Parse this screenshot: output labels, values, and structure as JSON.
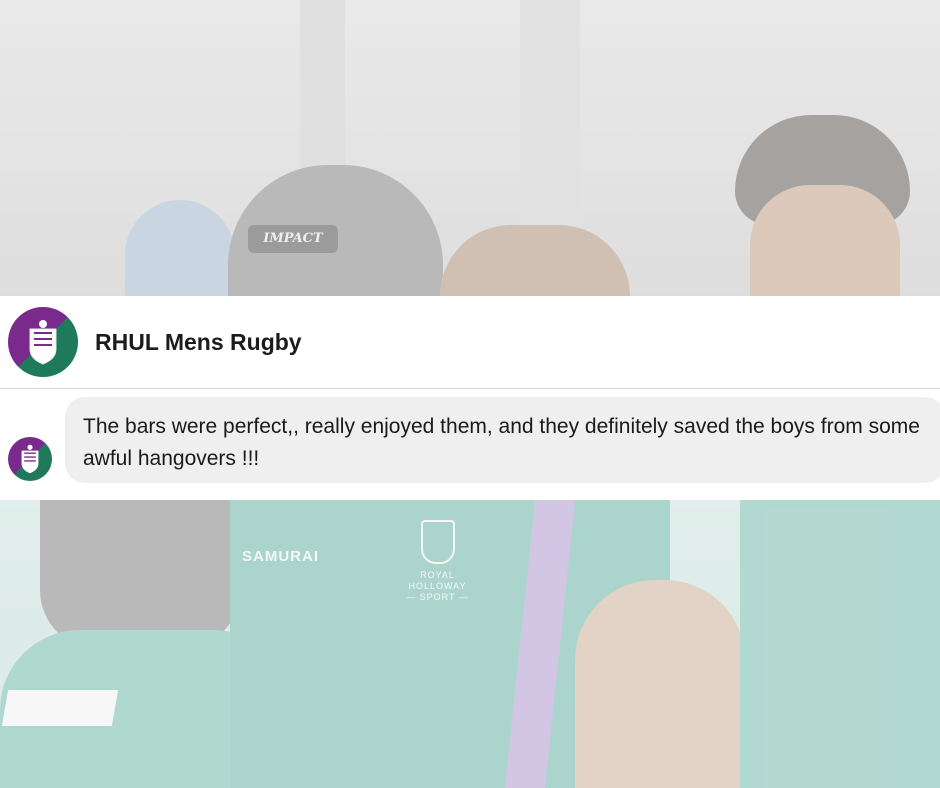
{
  "post": {
    "page_name": "RHUL Mens Rugby"
  },
  "comment": {
    "text": "The bars were perfect,,  really enjoyed them, and they definitely saved the boys from some awful hangovers !!!"
  },
  "background": {
    "helmet_text": "IMPACT",
    "shirt_brand": "SAMURAI",
    "shirt_crest_lines": [
      "ROYAL",
      "HOLLOWAY",
      "— SPORT —"
    ]
  },
  "colors": {
    "avatar_purple": "#7a2a8c",
    "avatar_green": "#1f7a5c",
    "bubble_bg": "#efefef",
    "card_bg": "#ffffff"
  },
  "icons": {
    "page_avatar": "university-crest-icon",
    "comment_avatar": "university-crest-icon"
  }
}
